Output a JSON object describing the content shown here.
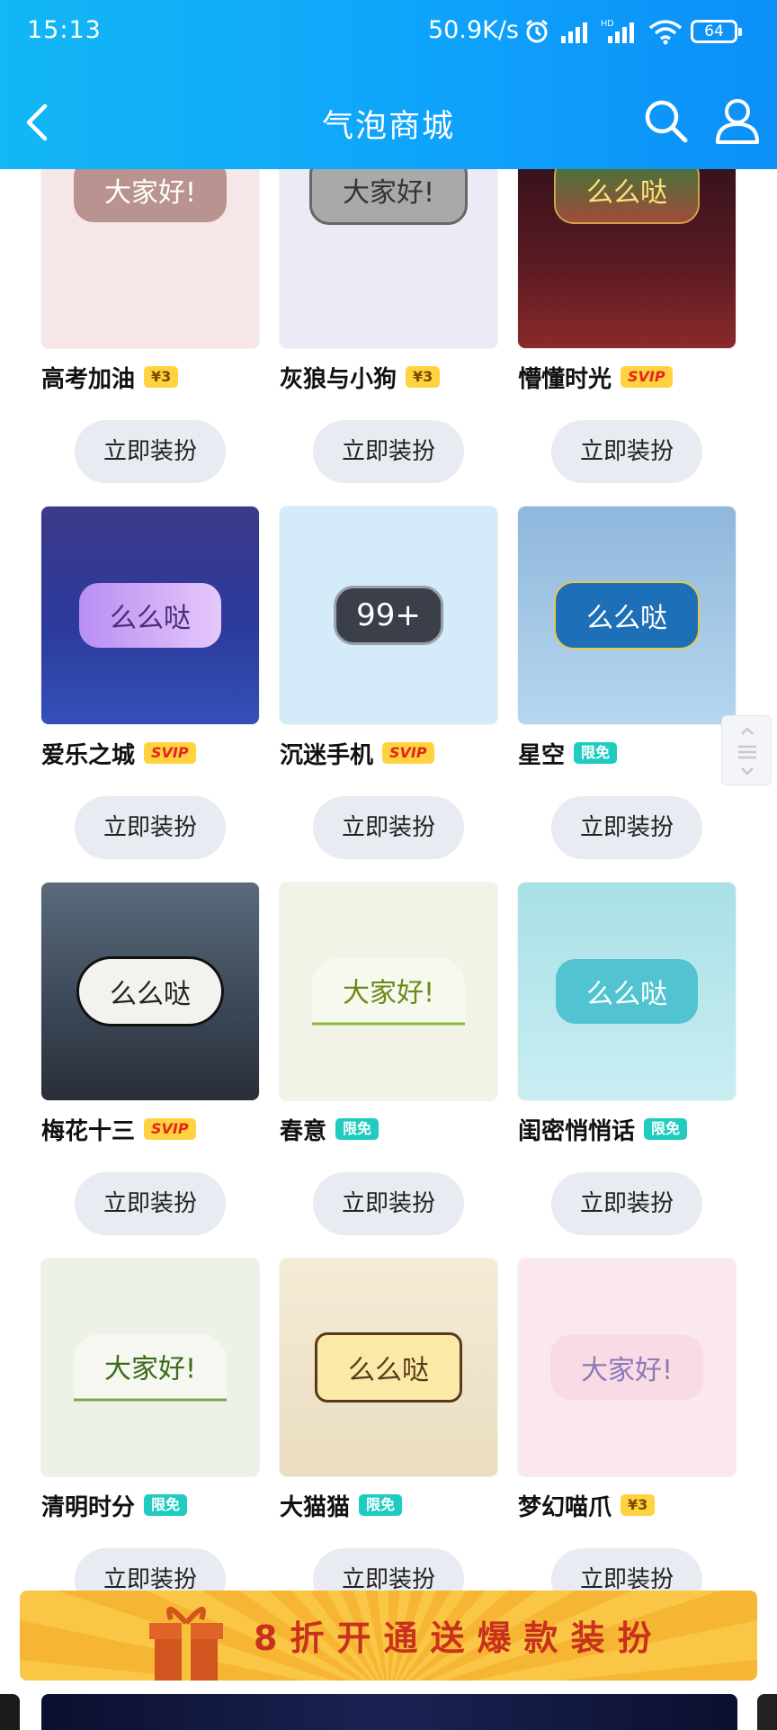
{
  "status_bar": {
    "time": "15:13",
    "net_speed": "50.9K/s",
    "battery": "64"
  },
  "nav": {
    "title": "气泡商城"
  },
  "items": [
    {
      "name": "高考加油",
      "tag": "¥3",
      "tag_type": "price",
      "bubble_text": "大家好!",
      "button": "立即装扮"
    },
    {
      "name": "灰狼与小狗",
      "tag": "¥3",
      "tag_type": "price",
      "bubble_text": "大家好!",
      "button": "立即装扮"
    },
    {
      "name": "懵懂时光",
      "tag": "SVIP",
      "tag_type": "svip",
      "bubble_text": "么么哒",
      "button": "立即装扮"
    },
    {
      "name": "爱乐之城",
      "tag": "SVIP",
      "tag_type": "svip",
      "bubble_text": "么么哒",
      "button": "立即装扮"
    },
    {
      "name": "沉迷手机",
      "tag": "SVIP",
      "tag_type": "svip",
      "bubble_text": "99+",
      "button": "立即装扮"
    },
    {
      "name": "星空",
      "tag": "限免",
      "tag_type": "free",
      "bubble_text": "么么哒",
      "button": "立即装扮"
    },
    {
      "name": "梅花十三",
      "tag": "SVIP",
      "tag_type": "svip",
      "bubble_text": "么么哒",
      "button": "立即装扮"
    },
    {
      "name": "春意",
      "tag": "限免",
      "tag_type": "free",
      "bubble_text": "大家好!",
      "button": "立即装扮"
    },
    {
      "name": "闺密悄悄话",
      "tag": "限免",
      "tag_type": "free",
      "bubble_text": "么么哒",
      "button": "立即装扮"
    },
    {
      "name": "清明时分",
      "tag": "限免",
      "tag_type": "free",
      "bubble_text": "大家好!",
      "button": "立即装扮"
    },
    {
      "name": "大猫猫",
      "tag": "限免",
      "tag_type": "free",
      "bubble_text": "么么哒",
      "button": "立即装扮"
    },
    {
      "name": "梦幻喵爪",
      "tag": "¥3",
      "tag_type": "price",
      "bubble_text": "大家好!",
      "button": "立即装扮"
    }
  ],
  "banner": {
    "text": "8折开通送爆款装扮"
  },
  "colors": {
    "header_start": "#12b7f5",
    "header_end": "#0b8ff8",
    "button_bg": "#e8ebf2"
  }
}
